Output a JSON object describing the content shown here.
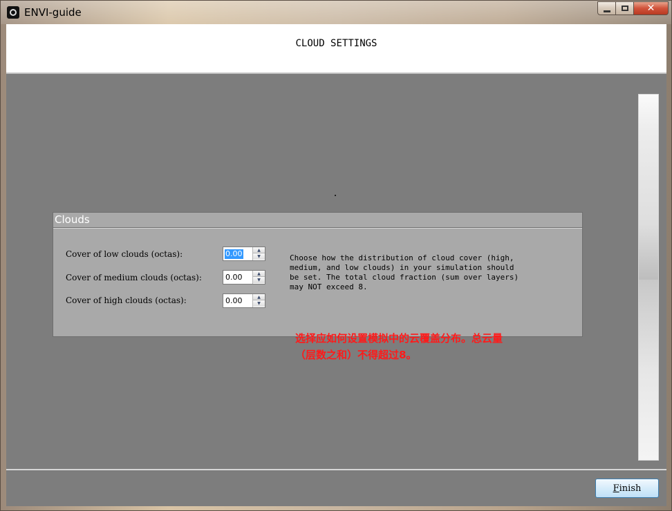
{
  "window": {
    "title": "ENVI-guide",
    "icon": "envi-app-icon",
    "controls": {
      "minimize": "minimize-icon",
      "maximize": "maximize-icon",
      "close": "close-icon",
      "close_glyph": "✕"
    }
  },
  "header": {
    "title": "CLOUD SETTINGS"
  },
  "clouds": {
    "group_title": "Clouds",
    "fields": [
      {
        "label": "Cover of low clouds (octas):",
        "value": "0.00",
        "selected": true
      },
      {
        "label": "Cover of medium clouds (octas):",
        "value": "0.00",
        "selected": false
      },
      {
        "label": "Cover of high clouds (octas):",
        "value": "0.00",
        "selected": false
      }
    ],
    "description": "Choose how the distribution of cloud cover (high,\nmedium, and low clouds) in your simulation should\nbe set. The total cloud fraction (sum over layers)\nmay NOT exceed 8.",
    "annotation": "选择应如何设置模拟中的云覆盖分布。总云量\n（层数之和）不得超过8。"
  },
  "footer": {
    "finish_mnemonic": "F",
    "finish_rest": "inish"
  },
  "colors": {
    "annotation": "#ff1a1a",
    "panel_bg": "#7d7d7d",
    "group_bg": "#a9a9a9",
    "selection": "#3399ff"
  }
}
